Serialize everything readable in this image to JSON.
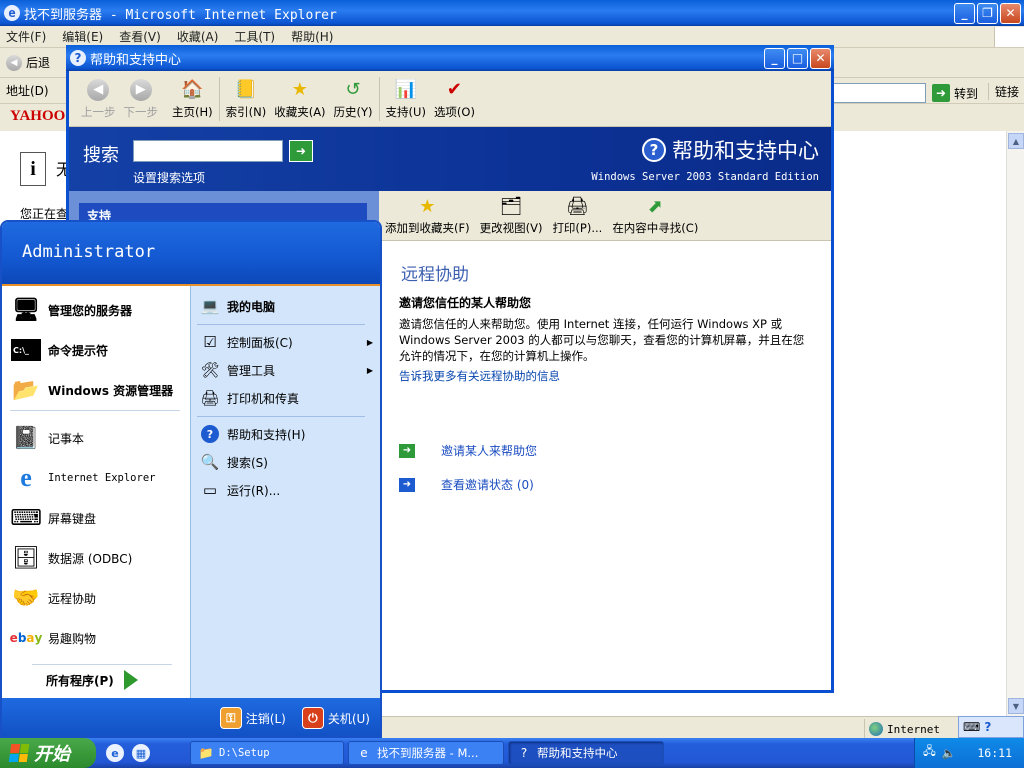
{
  "ie": {
    "title": "找不到服务器 - Microsoft Internet Explorer",
    "menu": [
      "文件(F)",
      "编辑(E)",
      "查看(V)",
      "收藏(A)",
      "工具(T)",
      "帮助(H)"
    ],
    "back_label": "后退",
    "address_label": "地址(D)",
    "go_label": "转到",
    "links_label": "链接",
    "yahoo_text": "YAHOO",
    "info_title": "无",
    "info_line": "您正在查",
    "status_zone": "Internet"
  },
  "help": {
    "title": "帮助和支持中心",
    "toolbar": [
      {
        "label": "上一步",
        "icon": "back-icon",
        "enabled": false
      },
      {
        "label": "下一步",
        "icon": "forward-icon",
        "enabled": false
      },
      {
        "label": "主页(H)",
        "icon": "home-icon",
        "enabled": true
      },
      {
        "label": "索引(N)",
        "icon": "index-icon",
        "enabled": true
      },
      {
        "label": "收藏夹(A)",
        "icon": "favorites-icon",
        "enabled": true
      },
      {
        "label": "历史(Y)",
        "icon": "history-icon",
        "enabled": true
      },
      {
        "label": "支持(U)",
        "icon": "support-icon",
        "enabled": true
      },
      {
        "label": "选项(O)",
        "icon": "options-icon",
        "enabled": true
      }
    ],
    "search_label": "搜索",
    "search_value": "",
    "search_options": "设置搜索选项",
    "brand": "帮助和支持中心",
    "edition": "Windows Server 2003 Standard Edition",
    "left_header": "支持",
    "actions": [
      "添加到收藏夹(F)",
      "更改视图(V)",
      "打印(P)...",
      "在内容中寻找(C)"
    ],
    "heading": "远程协助",
    "subheading": "邀请您信任的某人帮助您",
    "body": "邀请您信任的人来帮助您。使用 Internet 连接，任何运行 Windows XP 或 Windows Server 2003 的人都可以与您聊天，查看您的计算机屏幕，并且在您允许的情况下，在您的计算机上操作。",
    "more_link": "告诉我更多有关远程协助的信息",
    "tasks": [
      "邀请某人来帮助您",
      "查看邀请状态 (0)"
    ],
    "task_colors": [
      "#2f9a3a",
      "#1d5bd1"
    ]
  },
  "start_menu": {
    "user": "Administrator",
    "pinned": [
      "管理您的服务器",
      "命令提示符",
      "Windows 资源管理器"
    ],
    "recent": [
      "记事本",
      "Internet Explorer",
      "屏幕键盘",
      "数据源 (ODBC)",
      "远程协助",
      "易趣购物"
    ],
    "all_programs": "所有程序(P)",
    "right": [
      "我的电脑",
      "控制面板(C)",
      "管理工具",
      "打印机和传真",
      "帮助和支持(H)",
      "搜索(S)",
      "运行(R)..."
    ],
    "logoff": "注销(L)",
    "shutdown": "关机(U)"
  },
  "taskbar": {
    "start_label": "开始",
    "tasks": [
      "D:\\Setup",
      "找不到服务器 - M...",
      "帮助和支持中心"
    ],
    "clock": "16:11"
  }
}
